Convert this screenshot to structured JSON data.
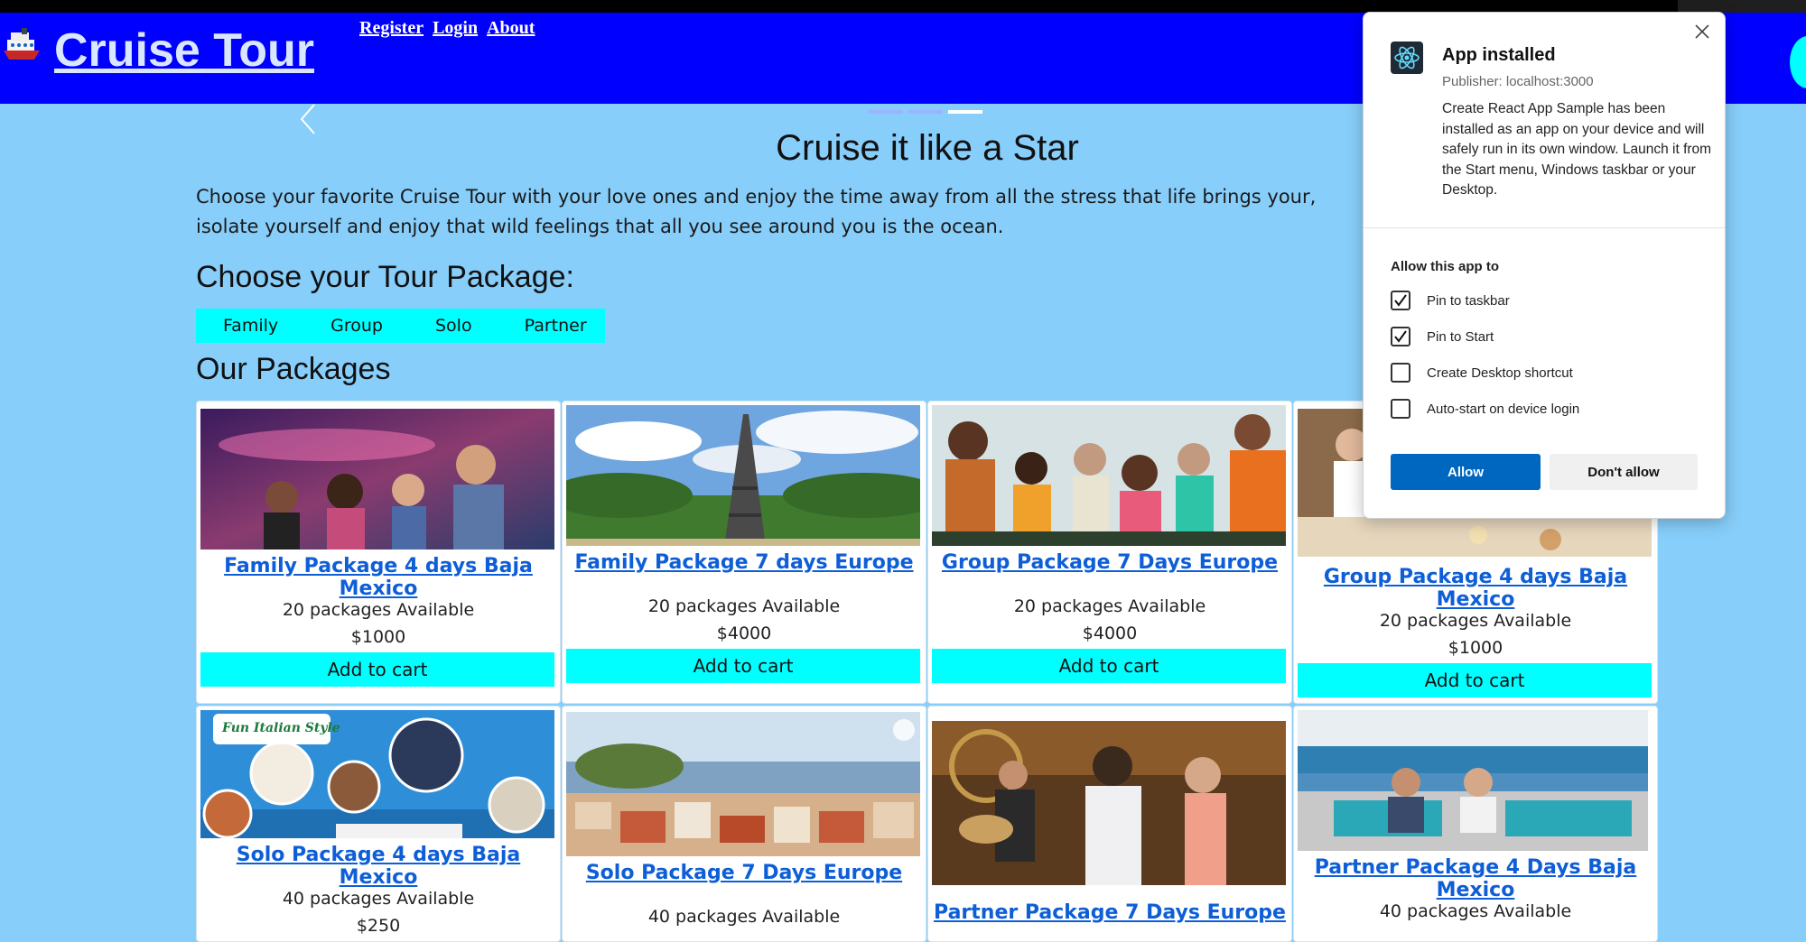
{
  "header": {
    "site_title": "Cruise Tour",
    "logo_icon": "ship-icon",
    "nav": [
      "Register",
      "Login",
      "About"
    ]
  },
  "carousel": {
    "slide_count": 3,
    "active_slide": 3
  },
  "hero": {
    "title": "Cruise it like a Star",
    "text": "Choose your favorite Cruise Tour with your love ones and enjoy the time away from all the stress that life brings your, isolate yourself and enjoy that wild feelings that all you see around you is the ocean."
  },
  "tour_package": {
    "title": "Choose your Tour Package:",
    "filters": [
      "Family",
      "Group",
      "Solo",
      "Partner"
    ]
  },
  "packages": {
    "title": "Our Packages",
    "cart_label": "Add to cart",
    "items": [
      {
        "name": "Family Package 4 days Baja Mexico",
        "available": "20 packages Available",
        "price": "$1000"
      },
      {
        "name": "Family Package 7 days Europe",
        "available": "20 packages Available",
        "price": "$4000"
      },
      {
        "name": "Group Package 7 Days Europe",
        "available": "20 packages Available",
        "price": "$4000"
      },
      {
        "name": "Group Package 4 days Baja Mexico",
        "available": "20 packages Available",
        "price": "$1000"
      },
      {
        "name": "Solo Package 4 days Baja Mexico",
        "available": "40 packages Available",
        "price": "$250",
        "image_text": "Fun Italian Style"
      },
      {
        "name": "Solo Package 7 Days Europe",
        "available": "40 packages Available"
      },
      {
        "name": "Partner Package 7 Days Europe"
      },
      {
        "name": "Partner Package 4 Days Baja Mexico",
        "available": "40 packages Available"
      }
    ]
  },
  "app_installed_dialog": {
    "title": "App installed",
    "publisher": "Publisher: localhost:3000",
    "description": "Create React App Sample has been installed as an app on your device and will safely run in its own window. Launch it from the Start menu, Windows taskbar or your Desktop.",
    "allow_title": "Allow this app to",
    "options": [
      {
        "label": "Pin to taskbar",
        "checked": true
      },
      {
        "label": "Pin to Start",
        "checked": true
      },
      {
        "label": "Create Desktop shortcut",
        "checked": false
      },
      {
        "label": "Auto-start on device login",
        "checked": false
      }
    ],
    "allow_label": "Allow",
    "deny_label": "Don't allow"
  },
  "colors": {
    "page_bg": "#87cefa",
    "header_bg": "#0000ff",
    "accent_cyan": "#00ffff",
    "link_blue": "#0d5ed7",
    "primary_button": "#0067c0"
  }
}
